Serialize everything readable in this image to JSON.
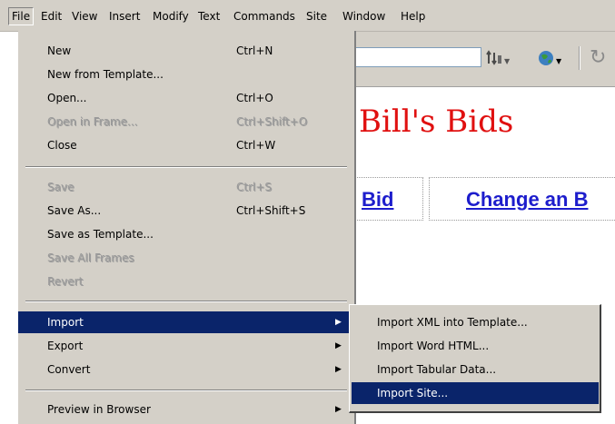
{
  "menubar": {
    "items": [
      {
        "label": "File"
      },
      {
        "label": "Edit"
      },
      {
        "label": "View"
      },
      {
        "label": "Insert"
      },
      {
        "label": "Modify"
      },
      {
        "label": "Text"
      },
      {
        "label": "Commands"
      },
      {
        "label": "Site"
      },
      {
        "label": "Window"
      },
      {
        "label": "Help"
      }
    ]
  },
  "toolbar": {
    "title_value": "",
    "icons": [
      "file-management-icon",
      "preview-globe-icon",
      "refresh-icon"
    ]
  },
  "document": {
    "title": "Bill's Bids",
    "nav": [
      "Bid",
      "Change an B"
    ]
  },
  "file_menu": {
    "items": [
      {
        "label": "New",
        "shortcut": "Ctrl+N"
      },
      {
        "label": "New from Template...",
        "shortcut": ""
      },
      {
        "label": "Open...",
        "shortcut": "Ctrl+O"
      },
      {
        "label": "Open in Frame...",
        "shortcut": "Ctrl+Shift+O"
      },
      {
        "label": "Close",
        "shortcut": "Ctrl+W"
      },
      {
        "label": "Save",
        "shortcut": "Ctrl+S"
      },
      {
        "label": "Save As...",
        "shortcut": "Ctrl+Shift+S"
      },
      {
        "label": "Save as Template...",
        "shortcut": ""
      },
      {
        "label": "Save All Frames",
        "shortcut": ""
      },
      {
        "label": "Revert",
        "shortcut": ""
      },
      {
        "label": "Import",
        "shortcut": ""
      },
      {
        "label": "Export",
        "shortcut": ""
      },
      {
        "label": "Convert",
        "shortcut": ""
      },
      {
        "label": "Preview in Browser",
        "shortcut": ""
      }
    ]
  },
  "import_submenu": {
    "items": [
      {
        "label": "Import XML into Template..."
      },
      {
        "label": "Import Word HTML..."
      },
      {
        "label": "Import Tabular Data..."
      },
      {
        "label": "Import Site..."
      }
    ]
  },
  "colors": {
    "menu_bg": "#d4d0c8",
    "selection": "#0a246a",
    "title_red": "#e01010",
    "link_blue": "#1d1dcc"
  }
}
